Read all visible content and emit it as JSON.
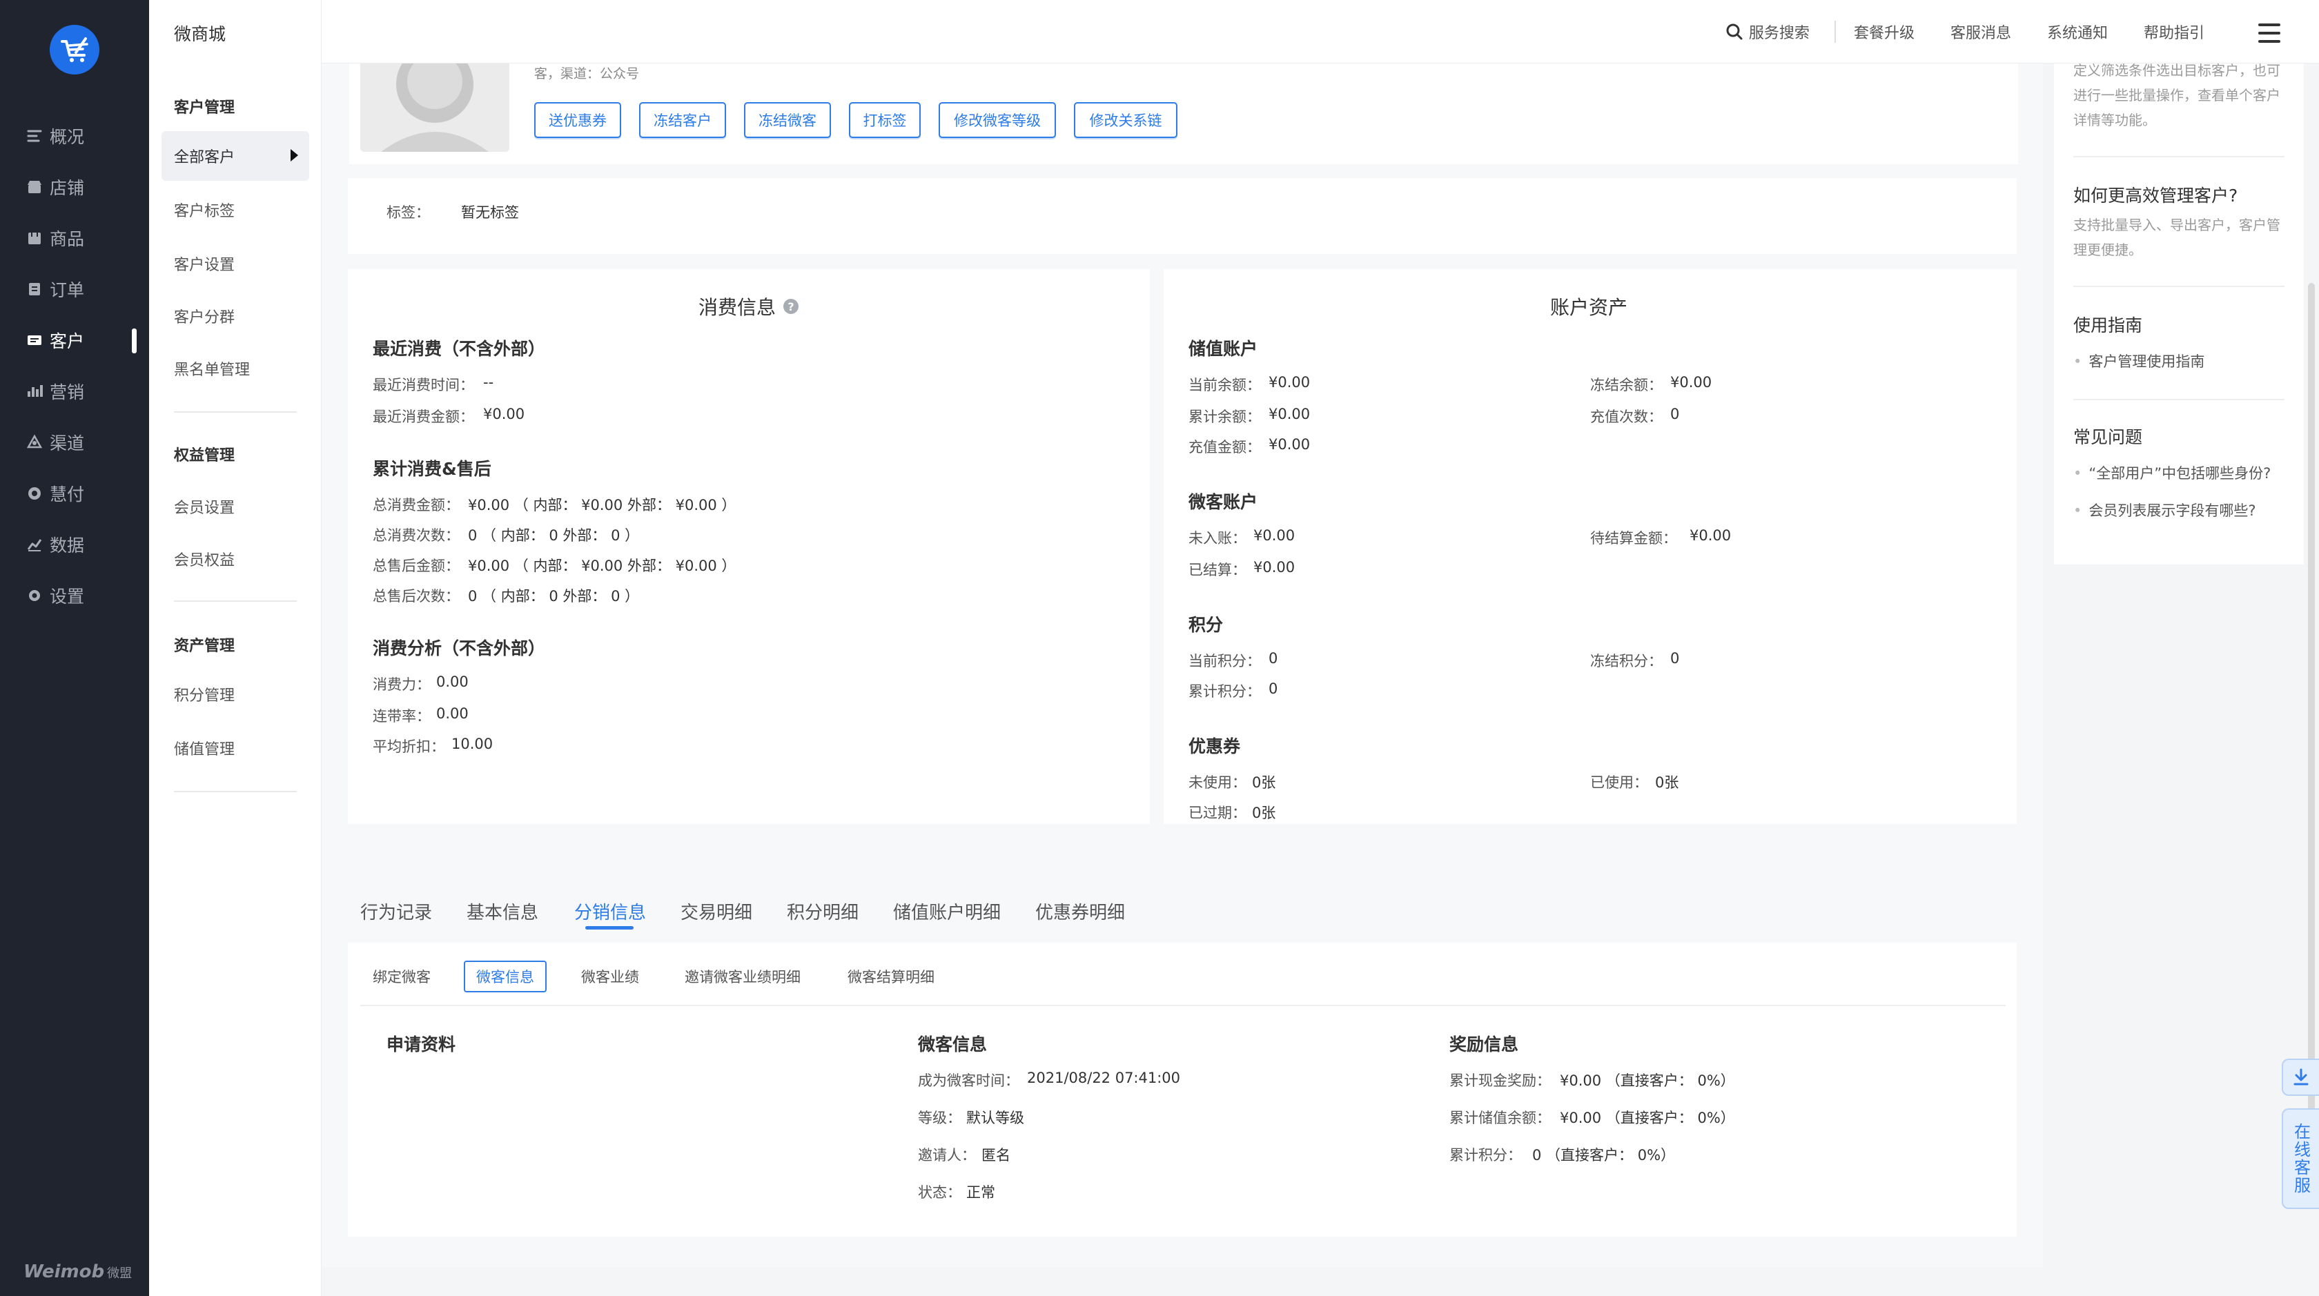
{
  "app_title": "微商城",
  "left_nav": {
    "items": [
      {
        "label": "概况",
        "icon": "overview-icon"
      },
      {
        "label": "店铺",
        "icon": "store-icon"
      },
      {
        "label": "商品",
        "icon": "goods-icon"
      },
      {
        "label": "订单",
        "icon": "order-icon"
      },
      {
        "label": "客户",
        "icon": "customer-icon"
      },
      {
        "label": "营销",
        "icon": "marketing-icon"
      },
      {
        "label": "渠道",
        "icon": "channel-icon"
      },
      {
        "label": "慧付",
        "icon": "pay-icon"
      },
      {
        "label": "数据",
        "icon": "data-icon"
      },
      {
        "label": "设置",
        "icon": "settings-icon"
      }
    ],
    "active_index": 4,
    "footer_brand": "Weimob",
    "footer_brand_cn": "微盟"
  },
  "sub_nav": {
    "groups": [
      {
        "title": "客户管理",
        "items": [
          "全部客户",
          "客户标签",
          "客户设置",
          "客户分群",
          "黑名单管理"
        ]
      },
      {
        "title": "权益管理",
        "items": [
          "会员设置",
          "会员权益"
        ]
      },
      {
        "title": "资产管理",
        "items": [
          "积分管理",
          "储值管理"
        ]
      }
    ],
    "active_item": "全部客户"
  },
  "topbar": {
    "links": [
      "服务搜索",
      "套餐升级",
      "客服消息",
      "系统通知",
      "帮助指引"
    ]
  },
  "profile": {
    "source_text": "客，渠道：公众号",
    "actions": [
      "送优惠券",
      "冻结客户",
      "冻结微客",
      "打标签",
      "修改微客等级",
      "修改关系链"
    ]
  },
  "tags": {
    "label": "标签：",
    "value": "暂无标签"
  },
  "consumption": {
    "title": "消费信息",
    "recent": {
      "heading": "最近消费（不含外部）",
      "rows": [
        {
          "label": "最近消费时间：",
          "value": "--"
        },
        {
          "label": "最近消费金额：",
          "value": "¥0.00"
        }
      ]
    },
    "cumulative": {
      "heading": "累计消费&售后",
      "rows": [
        {
          "label": "总消费金额：",
          "value": "¥0.00 （ 内部： ¥0.00    外部： ¥0.00 ）"
        },
        {
          "label": "总消费次数：",
          "value": "0 （ 内部： 0    外部： 0 ）"
        },
        {
          "label": "总售后金额：",
          "value": "¥0.00 （ 内部： ¥0.00    外部： ¥0.00 ）"
        },
        {
          "label": "总售后次数：",
          "value": "0 （ 内部： 0    外部： 0 ）"
        }
      ]
    },
    "analysis": {
      "heading": "消费分析（不含外部）",
      "rows": [
        {
          "label": "消费力：",
          "value": "0.00"
        },
        {
          "label": "连带率：",
          "value": "0.00"
        },
        {
          "label": "平均折扣：",
          "value": "10.00"
        }
      ]
    }
  },
  "assets": {
    "title": "账户资产",
    "stored_value": {
      "heading": "储值账户",
      "left": [
        {
          "label": "当前余额：",
          "value": "¥0.00"
        },
        {
          "label": "累计余额：",
          "value": "¥0.00"
        },
        {
          "label": "充值金额：",
          "value": "¥0.00"
        }
      ],
      "right": [
        {
          "label": "冻结余额：",
          "value": "¥0.00"
        },
        {
          "label": "充值次数：",
          "value": "0"
        }
      ]
    },
    "weike": {
      "heading": "微客账户",
      "left": [
        {
          "label": "未入账：",
          "value": "¥0.00"
        },
        {
          "label": "已结算：",
          "value": "¥0.00"
        }
      ],
      "right": [
        {
          "label": "待结算金额：",
          "value": "¥0.00"
        }
      ]
    },
    "points": {
      "heading": "积分",
      "left": [
        {
          "label": "当前积分：",
          "value": "0"
        },
        {
          "label": "累计积分：",
          "value": "0"
        }
      ],
      "right": [
        {
          "label": "冻结积分：",
          "value": "0"
        }
      ]
    },
    "coupons": {
      "heading": "优惠券",
      "left": [
        {
          "label": "未使用：",
          "value": "0张"
        },
        {
          "label": "已过期：",
          "value": "0张"
        }
      ],
      "right": [
        {
          "label": "已使用：",
          "value": "0张"
        }
      ]
    }
  },
  "tabs": [
    "行为记录",
    "基本信息",
    "分销信息",
    "交易明细",
    "积分明细",
    "储值账户明细",
    "优惠券明细"
  ],
  "active_tab": "分销信息",
  "subtabs": [
    "绑定微客",
    "微客信息",
    "微客业绩",
    "邀请微客业绩明细",
    "微客结算明细"
  ],
  "active_subtab": "微客信息",
  "distribution": {
    "apply": {
      "heading": "申请资料"
    },
    "weike_info": {
      "heading": "微客信息",
      "rows": [
        {
          "label": "成为微客时间：",
          "value": "2021/08/22 07:41:00"
        },
        {
          "label": "等级：",
          "value": "默认等级"
        },
        {
          "label": "邀请人：",
          "value": "匿名"
        },
        {
          "label": "状态：",
          "value": "正常"
        }
      ]
    },
    "rewards": {
      "heading": "奖励信息",
      "rows": [
        {
          "label": "累计现金奖励：",
          "value": "¥0.00    （直接客户： 0%）"
        },
        {
          "label": "累计储值余额：",
          "value": "¥0.00    （直接客户： 0%）"
        },
        {
          "label": "累计积分：",
          "value": "0    （直接客户： 0%）"
        }
      ]
    }
  },
  "help_panel": {
    "intro": "定义筛选条件选出目标客户，也可进行一些批量操作，查看单个客户详情等功能。",
    "q1_title": "如何更高效管理客户?",
    "q1_desc": "支持批量导入、导出客户，客户管理更便捷。",
    "guide_title": "使用指南",
    "guide_links": [
      "客户管理使用指南"
    ],
    "faq_title": "常见问题",
    "faq_links": [
      "“全部用户”中包括哪些身份?",
      "会员列表展示字段有哪些?"
    ]
  },
  "float": {
    "service_label": "在线客服"
  },
  "colors": {
    "accent": "#2d7ce8",
    "nav_bg": "#20242e",
    "logo_blue": "#1f6fe8"
  }
}
